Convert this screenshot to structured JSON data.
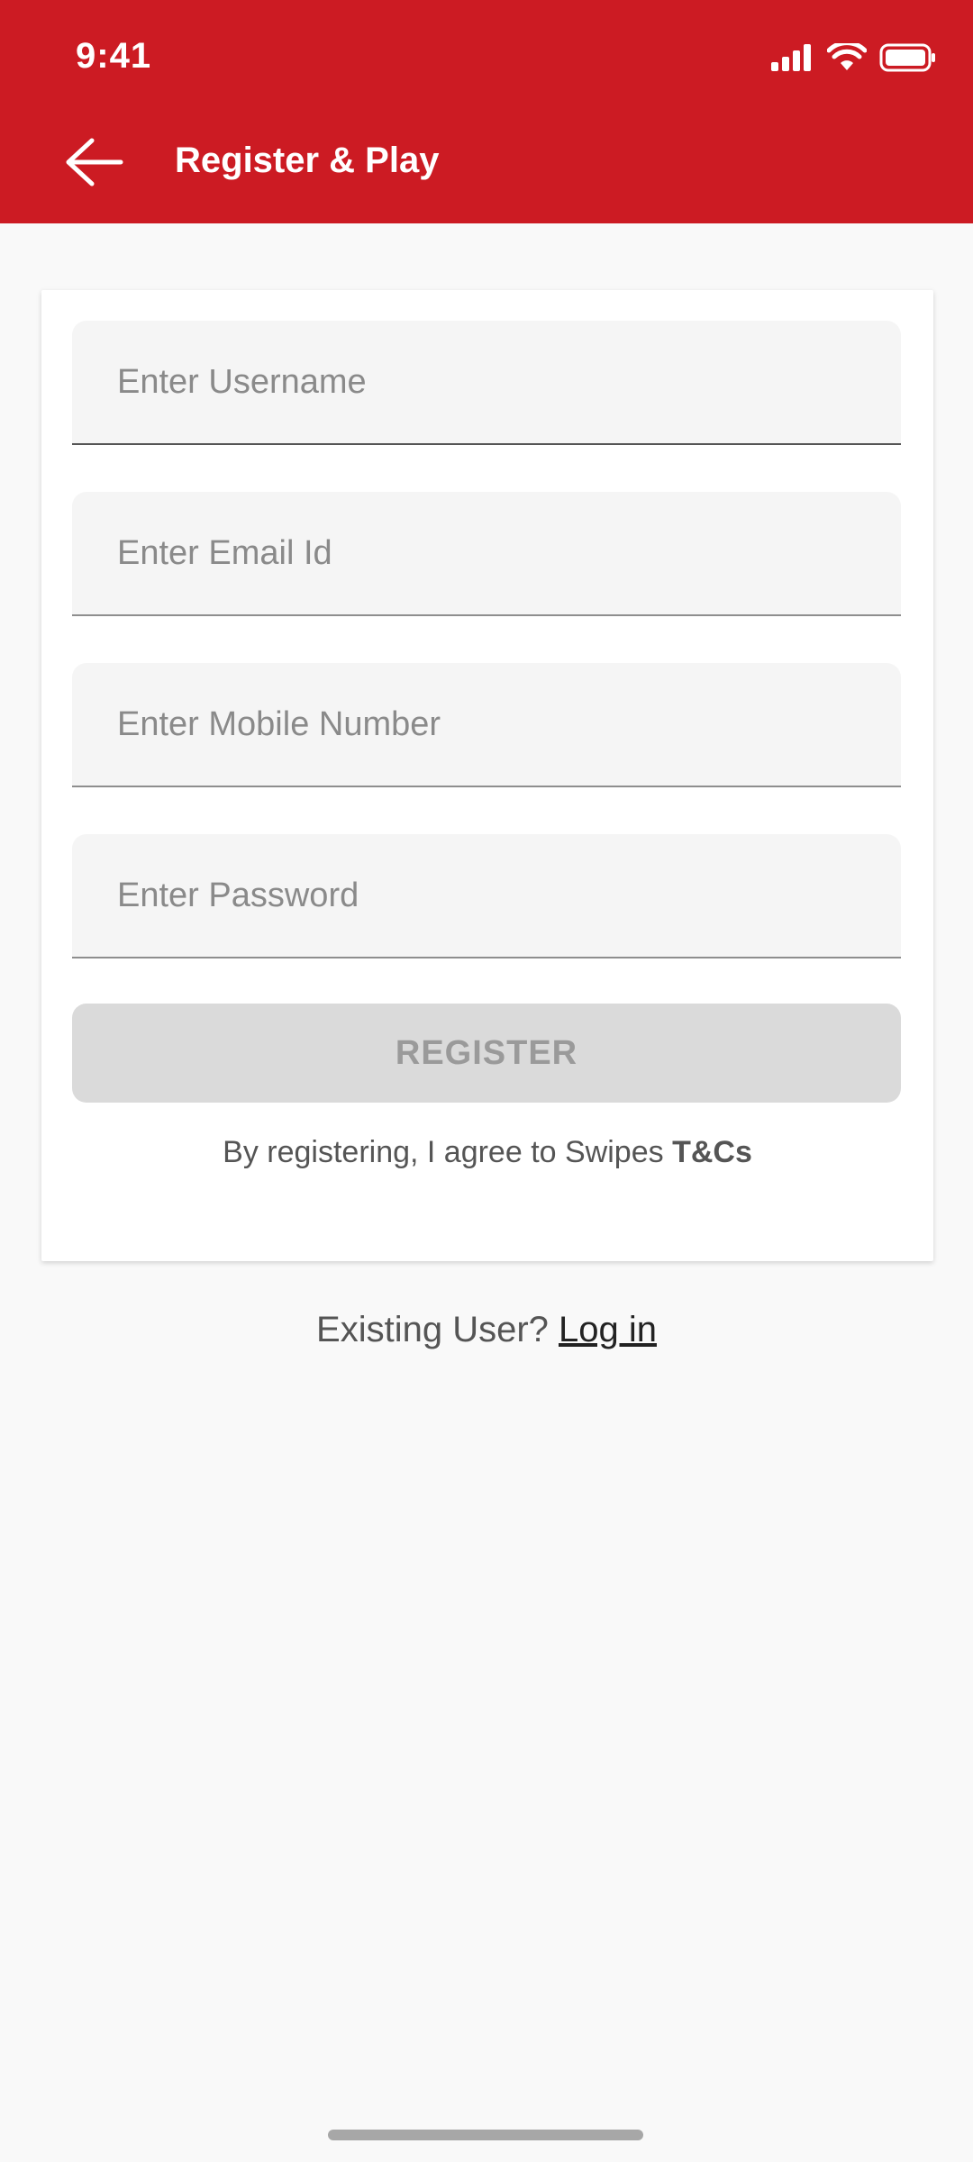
{
  "status_bar": {
    "time": "9:41",
    "icons": [
      "cellular-signal-icon",
      "wifi-icon",
      "battery-icon"
    ]
  },
  "header": {
    "title": "Register & Play",
    "background_color": "#cc1b23",
    "back_icon": "back-arrow-icon"
  },
  "form": {
    "username_placeholder": "Enter Username",
    "email_placeholder": "Enter Email Id",
    "mobile_placeholder": "Enter Mobile Number",
    "password_placeholder": "Enter Password",
    "register_label": "REGISTER",
    "terms_prefix": "By registering, I agree to Swipes ",
    "terms_link": "T&Cs"
  },
  "footer": {
    "existing_user_text": "Existing User? ",
    "login_link": "Log in"
  }
}
